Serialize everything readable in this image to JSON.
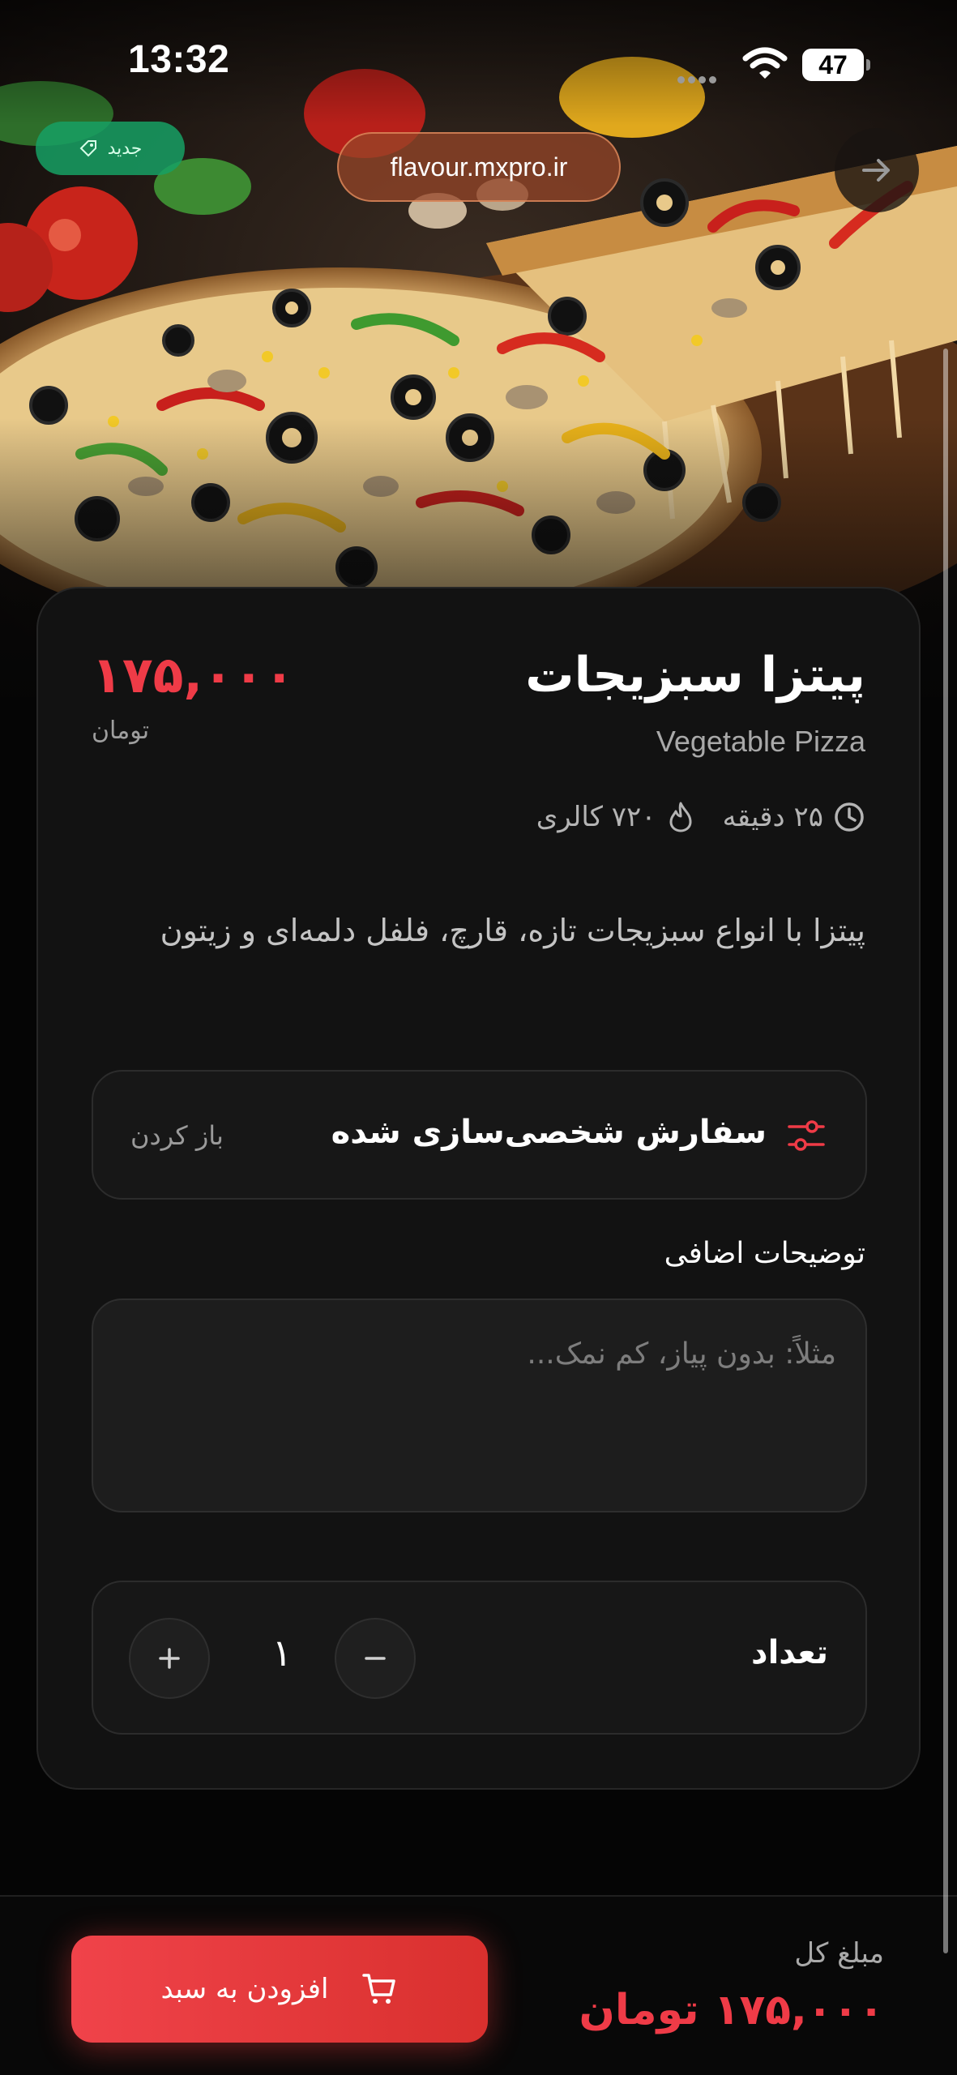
{
  "status_bar": {
    "time": "13:32",
    "battery": "47"
  },
  "hero": {
    "new_badge": "جدید",
    "url": "flavour.mxpro.ir"
  },
  "product": {
    "title": "پیتزا سبزیجات",
    "subtitle": "Vegetable Pizza",
    "price": "۱۷۵,۰۰۰",
    "price_unit": "تومان",
    "calories": "۷۲۰ کالری",
    "prep_time": "۲۵ دقیقه",
    "description": "پیتزا با انواع سبزیجات تازه، قارچ، فلفل دلمه‌ای و زیتون"
  },
  "customize": {
    "label": "سفارش شخصی‌سازی شده",
    "open_label": "باز کردن"
  },
  "notes": {
    "label": "توضیحات اضافی",
    "placeholder": "مثلاً: بدون پیاز، کم نمک..."
  },
  "quantity": {
    "label": "تعداد",
    "value": "۱",
    "plus": "+",
    "minus": "−"
  },
  "footer": {
    "total_label": "مبلغ کل",
    "total_value": "۱۷۵,۰۰۰ تومان",
    "add_to_cart_label": "افزودن به سبد"
  },
  "colors": {
    "accent": "#ef3b47",
    "card_bg": "#121212",
    "badge_green": "#16a064"
  },
  "icons": [
    "wifi-icon",
    "battery-icon",
    "tag-icon",
    "arrow-right-icon",
    "clock-icon",
    "flame-icon",
    "sliders-icon",
    "plus-icon",
    "minus-icon",
    "cart-icon"
  ]
}
